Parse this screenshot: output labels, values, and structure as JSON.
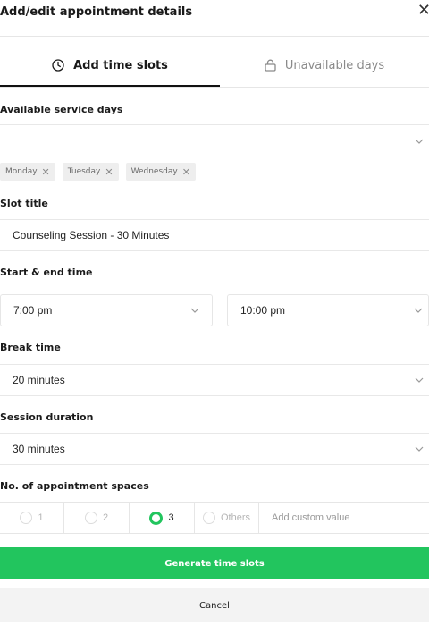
{
  "header": {
    "title": "Add/edit appointment details",
    "close_glyph": "✕"
  },
  "tabs": [
    {
      "label": "Add time slots",
      "icon": "clock-icon",
      "active": true
    },
    {
      "label": "Unavailable days",
      "icon": "lock-icon",
      "active": false
    }
  ],
  "service_days": {
    "label": "Available service days",
    "value": "",
    "chips": [
      "Monday",
      "Tuesday",
      "Wednesday"
    ],
    "remove_glyph": "✕"
  },
  "slot_title": {
    "label": "Slot title",
    "value": "Counseling Session - 30 Minutes"
  },
  "start_end": {
    "label": "Start & end time",
    "start": "7:00 pm",
    "end": "10:00 pm"
  },
  "break_time": {
    "label": "Break time",
    "value": "20 minutes"
  },
  "session_duration": {
    "label": "Session duration",
    "value": "30 minutes"
  },
  "spaces": {
    "label": "No. of appointment spaces",
    "options": [
      "1",
      "2",
      "3",
      "Others"
    ],
    "selected": "3",
    "custom_placeholder": "Add custom value"
  },
  "actions": {
    "generate": "Generate time slots",
    "cancel": "Cancel"
  },
  "colors": {
    "accent": "#22c55e",
    "active_tab_underline": "#111111",
    "chip_bg": "#eeeeee"
  }
}
